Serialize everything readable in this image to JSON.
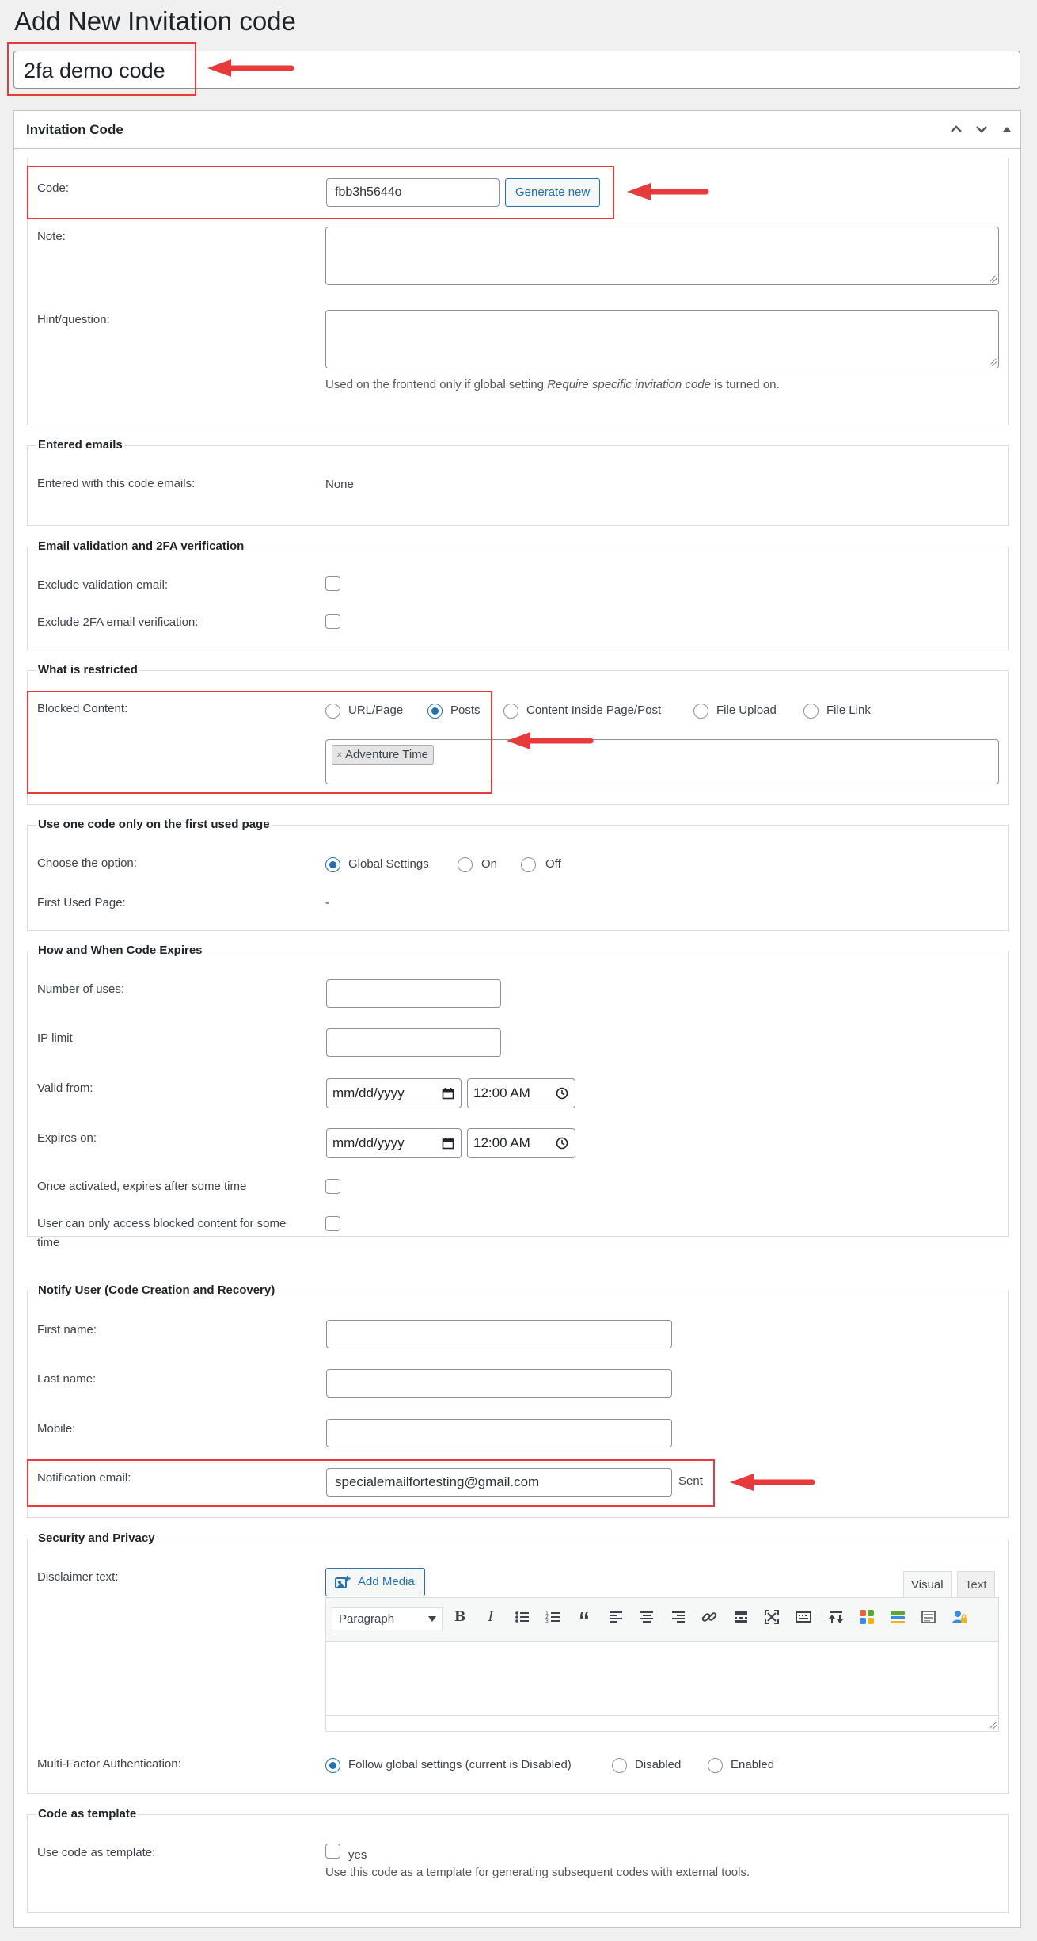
{
  "page_title": "Add New Invitation code",
  "title_value": "2fa demo code",
  "metabox": {
    "title": "Invitation Code",
    "icons": [
      "chevron-up-icon",
      "chevron-down-icon",
      "collapse-triangle-icon"
    ]
  },
  "main_fields": {
    "code_label": "Code:",
    "code_value": "fbb3h5644o",
    "generate_button": "Generate new",
    "note_label": "Note:",
    "hint_label": "Hint/question:",
    "hint_desc_pre": "Used on the frontend only if global setting ",
    "hint_desc_em": "Require specific invitation code",
    "hint_desc_post": " is turned on."
  },
  "entered_emails": {
    "legend": "Entered emails",
    "label": "Entered with this code emails:",
    "value": "None"
  },
  "email_validation": {
    "legend": "Email validation and 2FA verification",
    "exclude_validation_label": "Exclude validation email:",
    "exclude_2fa_label": "Exclude 2FA email verification:"
  },
  "restricted": {
    "legend": "What is restricted",
    "label": "Blocked Content:",
    "options": [
      "URL/Page",
      "Posts",
      "Content Inside Page/Post",
      "File Upload",
      "File Link"
    ],
    "selected": "Posts",
    "token": "Adventure Time",
    "token_remove": "×"
  },
  "one_code": {
    "legend": "Use one code only on the first used page",
    "choose_label": "Choose the option:",
    "options": [
      "Global Settings",
      "On",
      "Off"
    ],
    "selected": "Global Settings",
    "first_used_label": "First Used Page:",
    "first_used_value": "-"
  },
  "expires": {
    "legend": "How and When Code Expires",
    "uses_label": "Number of uses:",
    "ip_label": "IP limit",
    "valid_from_label": "Valid from:",
    "expires_on_label": "Expires on:",
    "date_placeholder": "mm/dd/yyyy",
    "time_value": "12:00 AM",
    "once_activated_label": "Once activated, expires after some time",
    "user_access_label_1": "User can only access blocked content for some",
    "user_access_label_2": "time"
  },
  "notify": {
    "legend": "Notify User (Code Creation and Recovery)",
    "first_name_label": "First name:",
    "last_name_label": "Last name:",
    "mobile_label": "Mobile:",
    "email_label": "Notification email:",
    "email_value": "specialemailfortesting@gmail.com",
    "sent_label": "Sent"
  },
  "security": {
    "legend": "Security and Privacy",
    "disclaimer_label": "Disclaimer text:",
    "add_media": "Add Media",
    "tab_visual": "Visual",
    "tab_text": "Text",
    "format_select": "Paragraph",
    "mfa_label": "Multi-Factor Authentication:",
    "mfa_options": [
      "Follow global settings (current is Disabled)",
      "Disabled",
      "Enabled"
    ],
    "mfa_selected": "Follow global settings (current is Disabled)"
  },
  "template": {
    "legend": "Code as template",
    "label": "Use code as template:",
    "checkbox_label": "yes",
    "desc": "Use this code as a template for generating subsequent codes with external tools."
  },
  "colors": {
    "accent": "#2271b1",
    "highlight": "#e83a3a",
    "border": "#8c8f94"
  }
}
